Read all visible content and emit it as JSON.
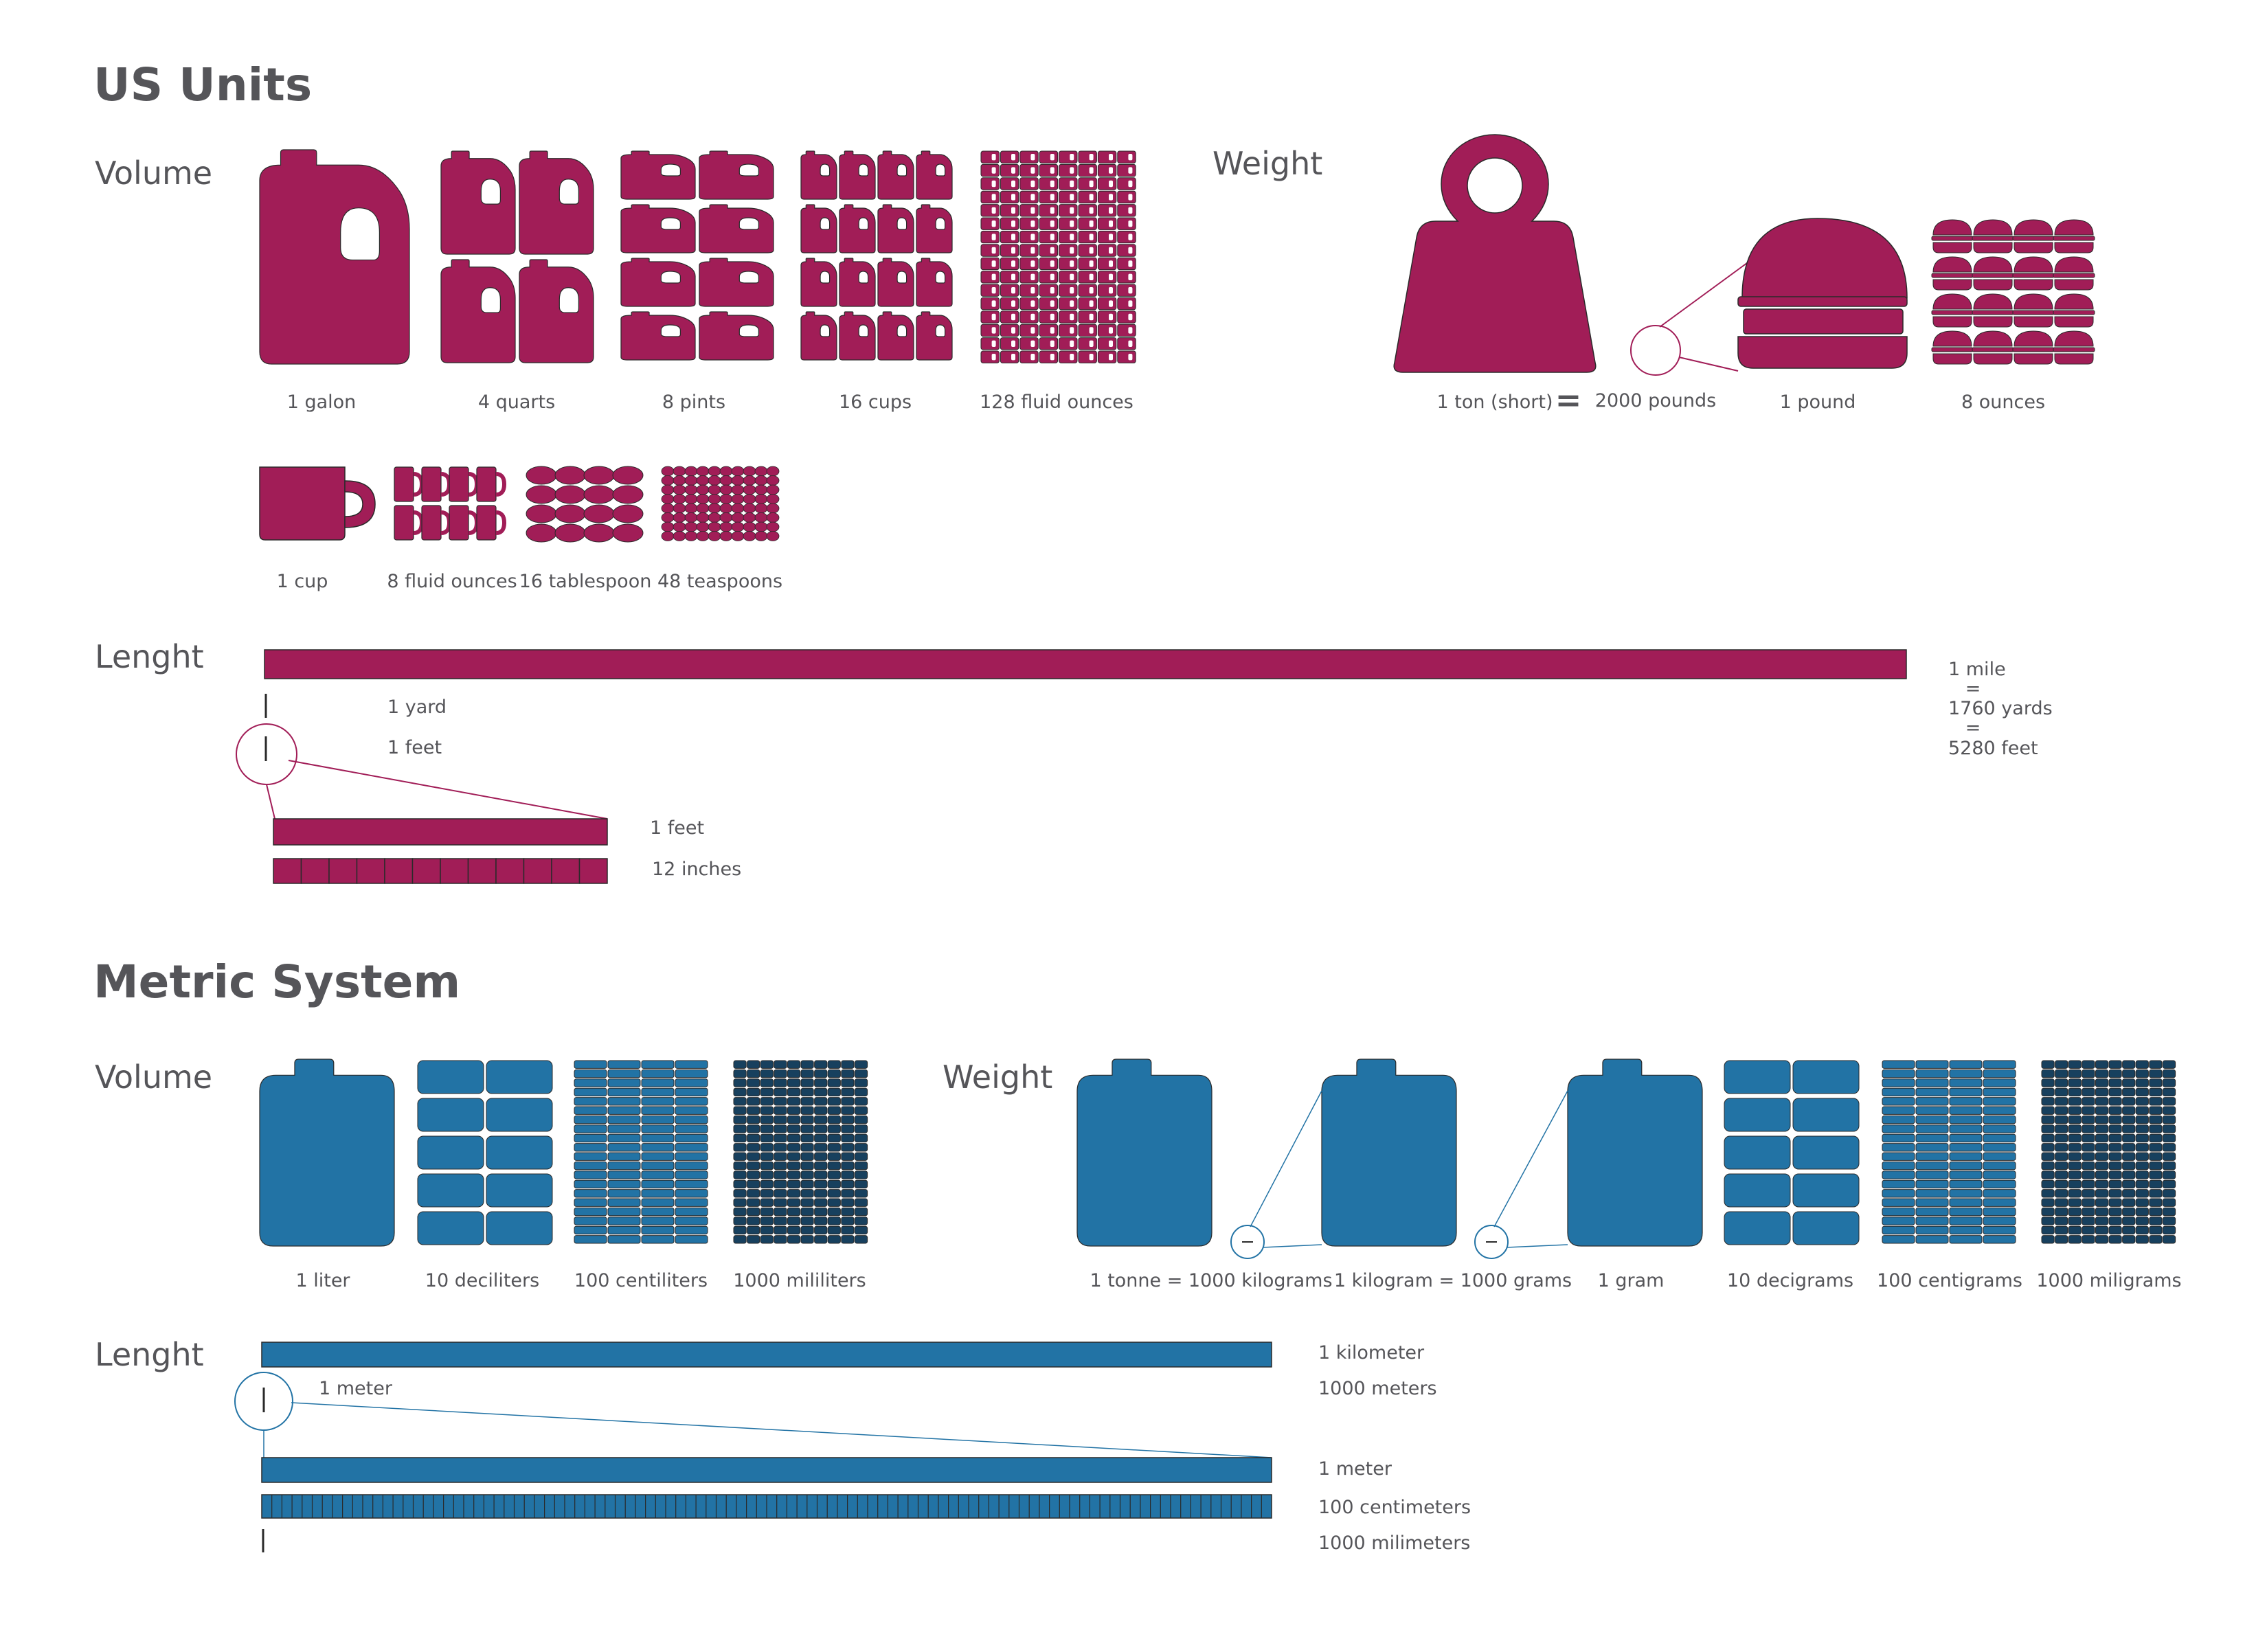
{
  "colors": {
    "us": "#a11d57",
    "metric": "#2273a5",
    "metric_dark": "#17405e",
    "text": "#555559",
    "stroke": "#2a2a2a"
  },
  "us": {
    "title": "US Units",
    "volume": {
      "heading": "Volume",
      "row1": [
        "1 galon",
        "4 quarts",
        "8 pints",
        "16 cups",
        "128 fluid ounces"
      ],
      "row2": [
        "1 cup",
        "8 fluid ounces",
        "16 tablespoon",
        "48 teaspoons"
      ]
    },
    "weight": {
      "heading": "Weight",
      "labels": [
        "1 ton (short)",
        "=",
        "2000 pounds",
        "1 pound",
        "8 ounces"
      ]
    },
    "length": {
      "heading": "Lenght",
      "labels": [
        "1 yard",
        "1 feet",
        "1 feet",
        "12 inches"
      ],
      "right": [
        "1 mile",
        "=",
        "1760 yards",
        "=",
        "5280 feet"
      ]
    }
  },
  "metric": {
    "title": "Metric System",
    "volume": {
      "heading": "Volume",
      "labels": [
        "1 liter",
        "10 deciliters",
        "100 centiliters",
        "1000 mililiters"
      ]
    },
    "weight": {
      "heading": "Weight",
      "labels": [
        "1 tonne = 1000 kilograms",
        "1 kilogram = 1000 grams",
        "1 gram",
        "10 decigrams",
        "100 centigrams",
        "1000 miligrams"
      ]
    },
    "length": {
      "heading": "Lenght",
      "labels": [
        "1 meter",
        "1 kilometer",
        "1000 meters",
        "1 meter",
        "100 centimeters",
        "1000 milimeters"
      ]
    }
  }
}
